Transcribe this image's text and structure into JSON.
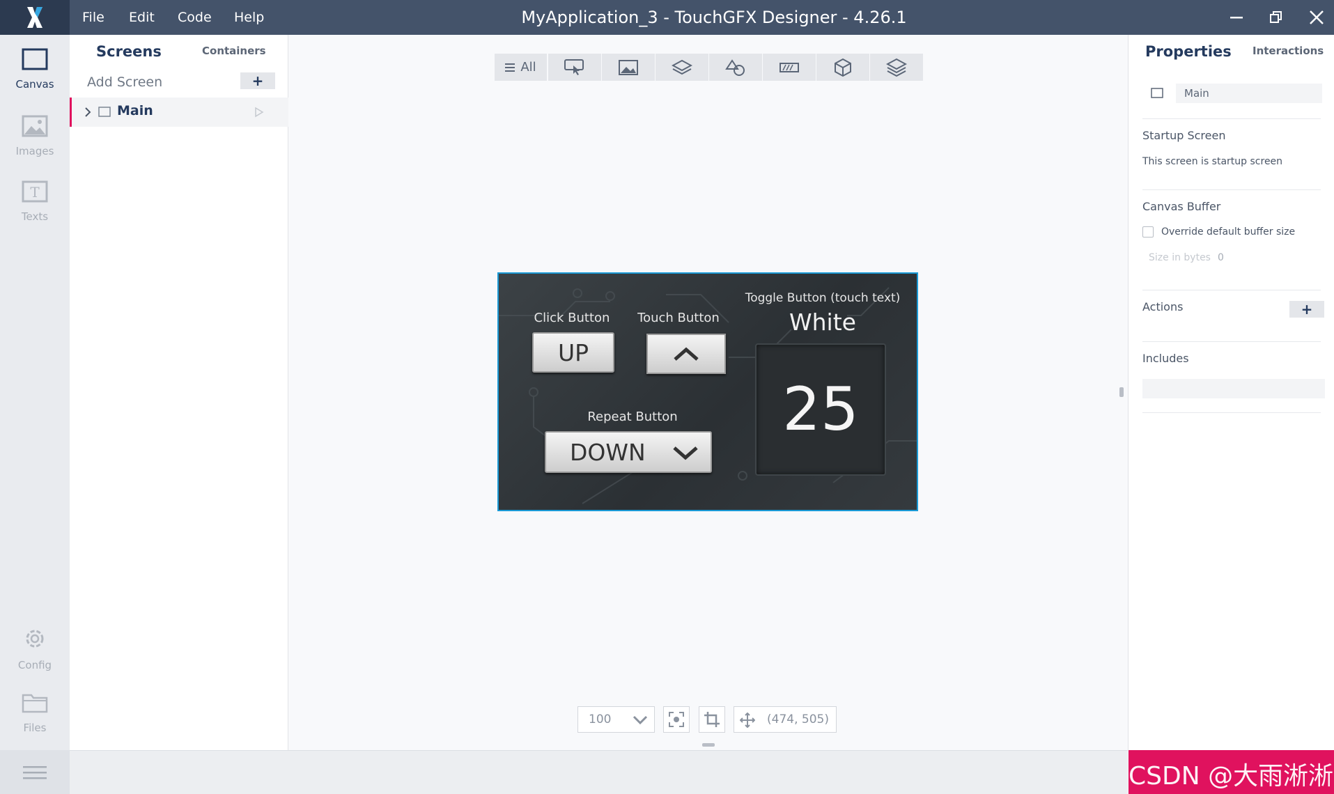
{
  "titlebar": {
    "title": "MyApplication_3 - TouchGFX Designer - 4.26.1",
    "menu": [
      "File",
      "Edit",
      "Code",
      "Help"
    ]
  },
  "leftnav": {
    "items": [
      {
        "label": "Canvas",
        "icon": "canvas-icon"
      },
      {
        "label": "Images",
        "icon": "images-icon"
      },
      {
        "label": "Texts",
        "icon": "texts-icon"
      },
      {
        "label": "Config",
        "icon": "gear-icon"
      },
      {
        "label": "Files",
        "icon": "folder-icon"
      }
    ]
  },
  "screens_panel": {
    "tab_screens": "Screens",
    "tab_containers": "Containers",
    "add_screen": "Add Screen",
    "add_symbol": "+",
    "screens": [
      {
        "name": "Main"
      }
    ]
  },
  "canvas_toolbar": {
    "all_label": "All",
    "icons": [
      "touch-icon",
      "image-icon",
      "container-icon",
      "shapes-icon",
      "progress-icon",
      "3d-icon",
      "layers-icon"
    ]
  },
  "device": {
    "click_button_label": "Click Button",
    "click_button_text": "UP",
    "touch_button_label": "Touch Button",
    "toggle_label": "Toggle Button (touch text)",
    "toggle_value": "White",
    "counter_value": "25",
    "repeat_button_label": "Repeat Button",
    "repeat_button_text": "DOWN"
  },
  "zoom_bar": {
    "zoom_value": "100",
    "coords": "(474, 505)"
  },
  "properties": {
    "tab_properties": "Properties",
    "tab_interactions": "Interactions",
    "screen_name": "Main",
    "startup_title": "Startup Screen",
    "startup_text": "This screen is startup screen",
    "canvas_buffer_title": "Canvas Buffer",
    "override_label": "Override default buffer size",
    "size_label": "Size in bytes",
    "size_value": "0",
    "actions_title": "Actions",
    "actions_add": "+",
    "includes_title": "Includes"
  },
  "watermark": {
    "text": "CSDN @大雨淅淅"
  },
  "colors": {
    "titlebar": "#44536a",
    "accent_pink": "#e0125e",
    "selection_blue": "#1a9ad6"
  }
}
